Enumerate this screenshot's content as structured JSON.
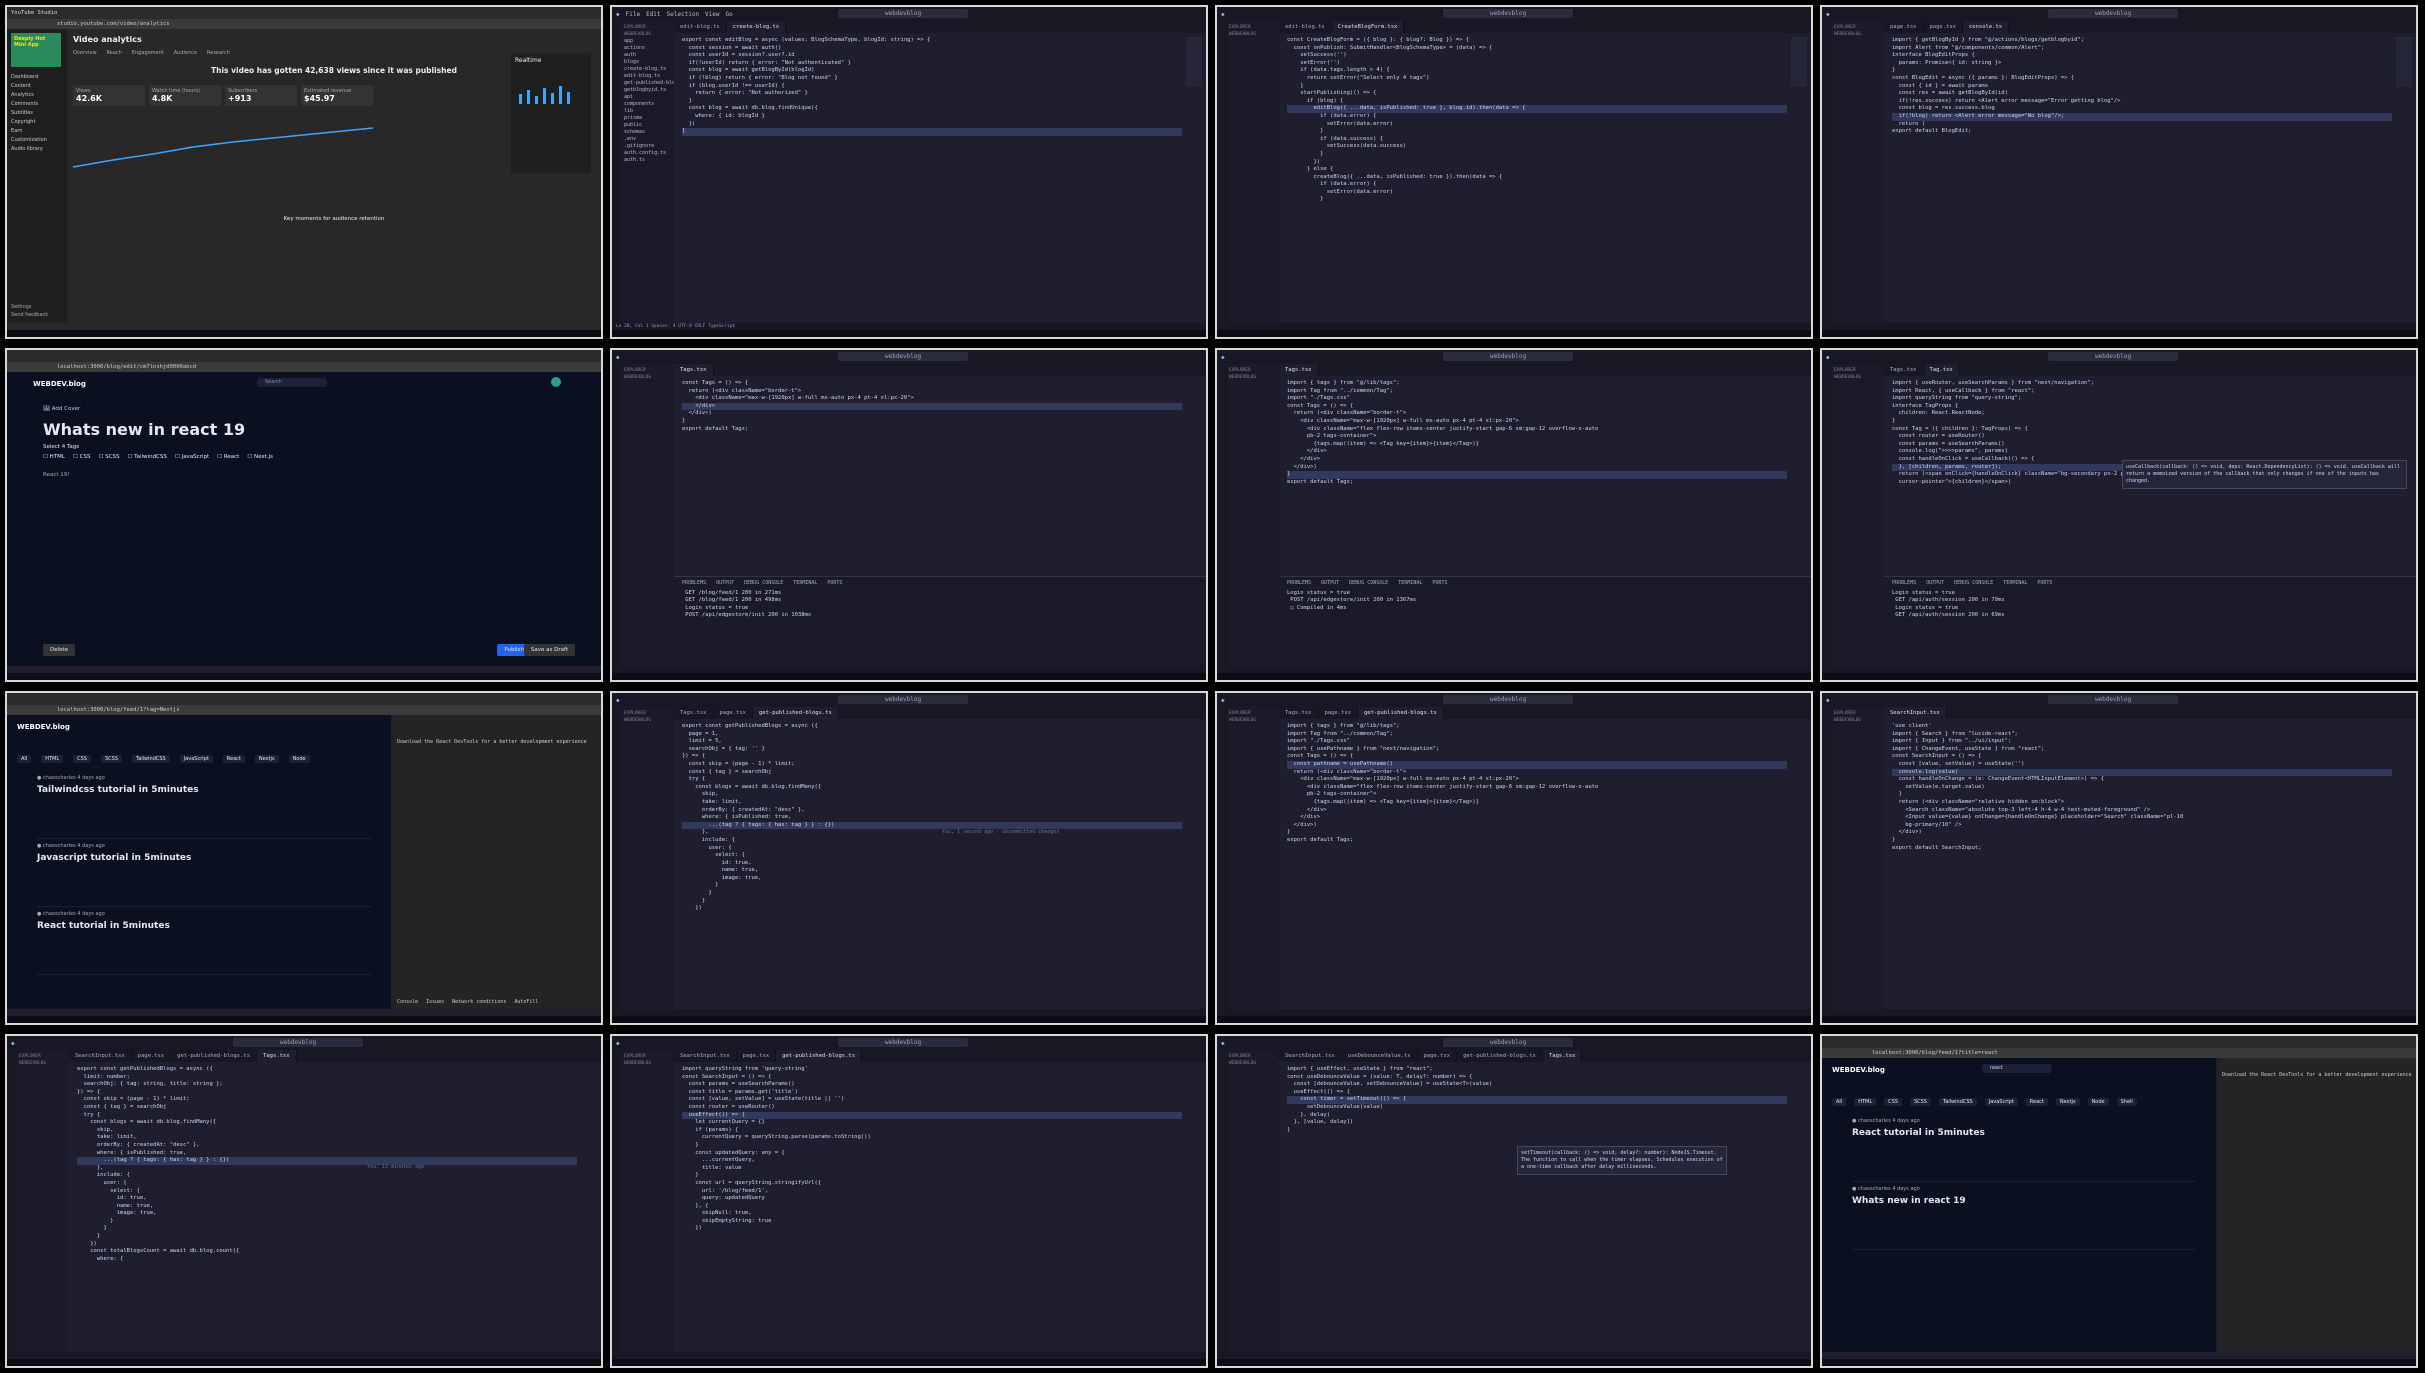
{
  "tiles": {
    "t1": {
      "tab": "YouTube Studio",
      "url": "studio.youtube.com/video/analytics",
      "sidebar_title": "Deeply Hot Mini App",
      "heading": "Video analytics",
      "tabs": [
        "Overview",
        "Reach",
        "Engagement",
        "Audience",
        "Research"
      ],
      "headline": "This video has gotten 42,638 views since it was published",
      "metrics": [
        "Views",
        "Watch time (hours)",
        "Subscribers",
        "Estimated revenue"
      ],
      "metric_values": [
        "42.6K",
        "4.8K",
        "+913",
        "$45.97"
      ],
      "menu": [
        "Dashboard",
        "Content",
        "Analytics",
        "Comments",
        "Subtitles",
        "Copyright",
        "Earn",
        "Customization",
        "Audio library"
      ],
      "realtime": "Realtime",
      "bottom": [
        "Settings",
        "Send feedback"
      ],
      "key": "Key moments for audience retention"
    },
    "t2": {
      "title": "webdevblog",
      "menu": [
        "File",
        "Edit",
        "Selection",
        "View",
        "Go"
      ],
      "tabs": [
        "edit-blog.ts",
        "create-blog.ts"
      ],
      "explorer_header": "EXPLORER",
      "project": "WEBDEVBLOG",
      "files": [
        "app",
        "actions",
        "auth",
        "blogs",
        "create-blog.ts",
        "edit-blog.ts",
        "get-published-blogs.ts",
        "getblogbyid.ts",
        "api",
        "components",
        "lib",
        "prisma",
        "public",
        "schemas",
        ".env",
        ".gitignore",
        "auth.config.ts",
        "auth.ts"
      ],
      "code": [
        "export const editBlog = async (values: BlogSchemaType, blogId: string) => {",
        "  const session = await auth()",
        "",
        "  const userId = session?.user?.id",
        "",
        "  if(!userId) return { error: \"Not authenticated\" }",
        "",
        "  const blog = await getBlogById(blogId)",
        "",
        "  if (!blog) return { error: \"Blog not found\" }",
        "",
        "  if (blog.userId !== userId) {",
        "    return { error: \"Not authorized\" }",
        "  }",
        "",
        "  const blog = await db.blog.findUnique({",
        "    where: { id: blogId }",
        "  })",
        "}"
      ],
      "status": "Ln 28, Col 1   Spaces: 4   UTF-8   CRLF   TypeScript"
    },
    "t3": {
      "title": "webdevblog",
      "tabs": [
        "edit-blog.ts",
        "CreateBlogForm.tsx"
      ],
      "code": [
        "const CreateBlogForm = ({ blog }: { blog?: Blog }) => {",
        "  const onPublish: SubmitHandler<BlogSchemaType> = (data) => {",
        "    setSuccess('')",
        "    setError('')",
        "",
        "    if (data.tags.length > 4) {",
        "      return setError(\"Select only 4 tags\")",
        "    }",
        "",
        "    startPublishing(() => {",
        "      if (blog) {",
        "        editBlog({ ...data, isPublished: true }, blog.id).then(data => {",
        "          if (data.error) {",
        "            setError(data.error)",
        "          }",
        "          if (data.success) {",
        "            setSuccess(data.success)",
        "          }",
        "        })",
        "      } else {",
        "        createBlog({ ...data, isPublished: true }).then(data => {",
        "          if (data.error) {",
        "            setError(data.error)",
        "          }"
      ]
    },
    "t4": {
      "title": "webdevblog",
      "tabs": [
        "page.tsx",
        "page.tsx",
        "console.ts"
      ],
      "code": [
        "import { getBlogById } from \"@/actions/blogs/getblogbyid\";",
        "import Alert from \"@/components/common/Alert\";",
        "",
        "interface BlogEditProps {",
        "  params: Promise<{ id: string }>",
        "}",
        "",
        "const BlogEdit = async ({ params }: BlogEditProps) => {",
        "  const { id } = await params",
        "",
        "  const res = await getBlogById(id)",
        "",
        "  if(!res.success) return <Alert error message=\"Error getting blog\"/>",
        "",
        "  const blog = res.success.blog",
        "",
        "  if(!blog) return <Alert error message=\"No blog\"/>;",
        "  return (",
        "",
        "export default BlogEdit;"
      ]
    },
    "t5": {
      "url": "localhost:3000/blog/edit/cm7lnshjd0000abcd",
      "logo": "WEBDEV.blog",
      "search": "Search",
      "cover": "Add Cover",
      "heading": "Whats new in react 19",
      "select": "Select 4 Tags",
      "tags": [
        "HTML",
        "CSS",
        "SCSS",
        "TailwindCSS",
        "JavaScript",
        "React",
        "Next.js"
      ],
      "content": "React 19!",
      "delete": "Delete",
      "publish": "Publish",
      "draft": "Save as Draft"
    },
    "t6": {
      "tabs": [
        "Tags.tsx"
      ],
      "code": [
        "const Tags = () => {",
        "  return (<div className=\"border-t\">",
        "    <div className=\"max-w-[1920px] w-full mx-auto px-4 pt-4 xl:px-20\">",
        "    </div>",
        "  </div>)",
        "}",
        "",
        "export default Tags;"
      ],
      "panel_tabs": [
        "PROBLEMS",
        "OUTPUT",
        "DEBUG CONSOLE",
        "TERMINAL",
        "PORTS"
      ],
      "terminal": [
        " GET /blog/feed/1 200 in 271ms",
        " GET /blog/feed/1 200 in 498ms",
        " Login status = true",
        " POST /api/edgestore/init 200 in 1038ms"
      ]
    },
    "t7": {
      "tabs": [
        "Tags.tsx"
      ],
      "code": [
        "import { tags } from \"@/lib/tags\";",
        "import Tag from \"../common/Tag\";",
        "",
        "import \"./Tags.css\"",
        "",
        "const Tags = () => {",
        "  return (<div className=\"border-t\">",
        "    <div className=\"max-w-[1920px] w-full mx-auto px-4 pt-4 xl:px-20\">",
        "      <div className=\"flex flex-row items-center justify-start gap-6 sm:gap-12 overflow-x-auto",
        "      pb-2 tags-container\">",
        "        {tags.map((item) => <Tag key={item}>{item}</Tag>)}",
        "      </div>",
        "    </div>",
        "  </div>)",
        "}",
        "",
        "export default Tags;"
      ],
      "terminal": [
        "Login status = true",
        " POST /api/edgestore/init 200 in 1367ms",
        " ○ Compiled in 4ms"
      ]
    },
    "t8": {
      "tabs": [
        "Tags.tsx",
        "Tag.tsx"
      ],
      "code": [
        "import { useRouter, useSearchParams } from \"next/navigation\";",
        "import React, { useCallback } from \"react\";",
        "import queryString from \"query-string\";",
        "",
        "interface TagProps {",
        "  children: React.ReactNode;",
        "}",
        "",
        "const Tag = ({ children }: TagProps) => {",
        "  const router = useRouter()",
        "  const params = useSearchParams()",
        "",
        "  console.log(\">>>>params\", params)",
        "",
        "  const handleOnClick = useCallback(() => {",
        "  }, [children, params, router]);",
        "",
        "  return (<span onClick={handleOnClick} className=\"bg-secondary px-2 py-1 rounded text-sm",
        "  cursor-pointer\">{children}</span>)"
      ],
      "hover": "useCallback(callback: () => void, deps: React.DependencyList): () => void. useCallback will return a memoized version of the callback that only changes if one of the inputs has changed.",
      "terminal": [
        "Login status = true",
        " GET /api/auth/session 200 in 79ms",
        " Login status = true",
        " GET /api/auth/session 200 in 69ms"
      ]
    },
    "t9": {
      "url": "localhost:3000/blog/feed/1?tag=Nextjs",
      "logo": "WEBDEV.blog",
      "tags": [
        "All",
        "HTML",
        "CSS",
        "SCSS",
        "TailwindCSS",
        "JavaScript",
        "React",
        "Nextjs",
        "Node"
      ],
      "author": "chaoscharles",
      "posts": [
        "Tailwindcss tutorial in 5minutes",
        "Javascript tutorial in 5minutes",
        "React tutorial in 5minutes"
      ],
      "age": "4 days ago",
      "console_tabs": [
        "Console",
        "Issues",
        "Network conditions",
        "AutoFill"
      ],
      "console_msg": "Download the React DevTools for a better development experience"
    },
    "t10": {
      "tabs": [
        "Tags.tsx",
        "page.tsx",
        "get-published-blogs.ts"
      ],
      "code": [
        "export const getPublishedBlogs = async ({",
        "  page = 1,",
        "  limit = 5,",
        "  searchObj = { tag: '' }",
        "}) => {",
        "  const skip = (page - 1) * limit;",
        "  const { tag } = searchObj",
        "",
        "  try {",
        "    const blogs = await db.blog.findMany({",
        "      skip,",
        "      take: limit,",
        "      orderBy: { createdAt: \"desc\" },",
        "      where: { isPublished: true,",
        "        ...(tag ? { tags: { has: tag } } : {})",
        "      },",
        "      include: {",
        "        user: {",
        "          select: {",
        "            id: true,",
        "            name: true,",
        "            image: true,",
        "          }",
        "        }",
        "      }",
        "    })"
      ],
      "blame": "You, 1 second ago · Uncommitted changes"
    },
    "t11": {
      "tabs": [
        "Tags.tsx",
        "page.tsx",
        "get-published-blogs.ts"
      ],
      "code": [
        "import { tags } from \"@/lib/tags\";",
        "import Tag from \"../common/Tag\";",
        "",
        "import \"./Tags.css\"",
        "import { usePathname } from \"next/navigation\";",
        "",
        "const Tags = () => {",
        "  const pathname = usePathname()",
        "  return (<div className=\"border-t\">",
        "    <div className=\"max-w-[1920px] w-full mx-auto px-4 pt-4 xl:px-20\">",
        "      <div className=\"flex flex-row items-center justify-start gap-6 sm:gap-12 overflow-x-auto",
        "      pb-2 tags-container\">",
        "        {tags.map((item) => <Tag key={item}>{item}</Tag>)}",
        "      </div>",
        "    </div>",
        "  </div>)",
        "}",
        "",
        "export default Tags;"
      ]
    },
    "t12": {
      "tabs": [
        "SearchInput.tsx"
      ],
      "code": [
        "'use client'",
        "",
        "import { Search } from \"lucide-react\";",
        "import { Input } from \"../ui/input\";",
        "import { ChangeEvent, useState } from \"react\";",
        "",
        "const SearchInput = () => {",
        "  const [value, setValue] = useState('')",
        "",
        "  console.log(value)",
        "",
        "  const handleOnChange = (e: ChangeEvent<HTMLInputElement>) => {",
        "    setValue(e.target.value)",
        "  }",
        "",
        "  return (<div className=\"relative hidden sm:block\">",
        "    <Search className=\"absolute top-3 left-4 h-4 w-4 text-muted-foreground\" />",
        "    <Input value={value} onChange={handleOnChange} placeholder=\"Search\" className=\"pl-10",
        "    bg-primary/10\" />",
        "  </div>)",
        "}",
        "",
        "export default SearchInput;"
      ]
    },
    "t13": {
      "tabs": [
        "SearchInput.tsx",
        "page.tsx",
        "get-published-blogs.ts",
        "Tags.tsx"
      ],
      "code": [
        "export const getPublishedBlogs = async ({",
        "  limit: number;",
        "  searchObj: { tag: string, title: string };",
        "}) => {",
        "  const skip = (page - 1) * limit;",
        "  const { tag } = searchObj",
        "",
        "  try {",
        "    const blogs = await db.blog.findMany({",
        "      skip,",
        "      take: limit,",
        "      orderBy: { createdAt: \"desc\" },",
        "      where: { isPublished: true,",
        "        ...(tag ? { tags: { has: tag } } : {})",
        "      },",
        "      include: {",
        "        user: {",
        "          select: {",
        "            id: true,",
        "            name: true,",
        "            image: true,",
        "          }",
        "        }",
        "      }",
        "    })",
        "",
        "    const totalBlogsCount = await db.blog.count({",
        "      where: {"
      ],
      "blame": "You, 13 minutes ago"
    },
    "t14": {
      "tabs": [
        "SearchInput.tsx",
        "page.tsx",
        "get-published-blogs.ts"
      ],
      "code": [
        "import queryString from 'query-string'",
        "",
        "const SearchInput = () => {",
        "  const params = useSearchParams()",
        "  const title = params.get('title')",
        "  const [value, setValue] = useState(title || '')",
        "  const router = useRouter()",
        "",
        "  useEffect(() => {",
        "    let currentQuery = {}",
        "",
        "    if (params) {",
        "      currentQuery = queryString.parse(params.toString())",
        "    }",
        "",
        "    const updatedQuery: any = {",
        "      ...currentQuery,",
        "      title: value",
        "    }",
        "",
        "    const url = queryString.stringifyUrl({",
        "      url: '/blog/feed/1',",
        "      query: updatedQuery",
        "    }, {",
        "      skipNull: true,",
        "      skipEmptyString: true",
        "    })"
      ]
    },
    "t15": {
      "tabs": [
        "SearchInput.tsx",
        "useDebounceValue.ts",
        "page.tsx",
        "get-published-blogs.ts",
        "Tags.tsx"
      ],
      "code": [
        "import { useEffect, useState } from \"react\";",
        "",
        "const useDebounceValue = (value: T, delay?: number) => {",
        "  const [debounceValue, setDebounceValue] = useState<T>(value)",
        "",
        "  useEffect(() => {",
        "    const timer = setTimeout(() => {",
        "      setDebounceValue(value)",
        "    }, delay)",
        "  }, [value, delay])",
        "}"
      ],
      "hover": "setTimeout(callback: () => void, delay?: number): NodeJS.Timeout. The function to call when the timer elapses. Schedules execution of a one-time callback after delay milliseconds."
    },
    "t16": {
      "url": "localhost:3000/blog/feed/1?title=react",
      "logo": "WEBDEV.blog",
      "search": "react",
      "tags": [
        "All",
        "HTML",
        "CSS",
        "SCSS",
        "TailwindCSS",
        "JavaScript",
        "React",
        "Nextjs",
        "Node",
        "Shell"
      ],
      "posts": [
        "React tutorial in 5minutes",
        "Whats new in react 19"
      ],
      "author": "chaoscharles",
      "age": "4 days ago",
      "console_msg": "Download the React DevTools for a better development experience"
    }
  },
  "colors": {
    "bg": "#1e1e2e",
    "accent": "#89b4fa",
    "highlight": "#313a5c",
    "publish": "#2563eb"
  }
}
